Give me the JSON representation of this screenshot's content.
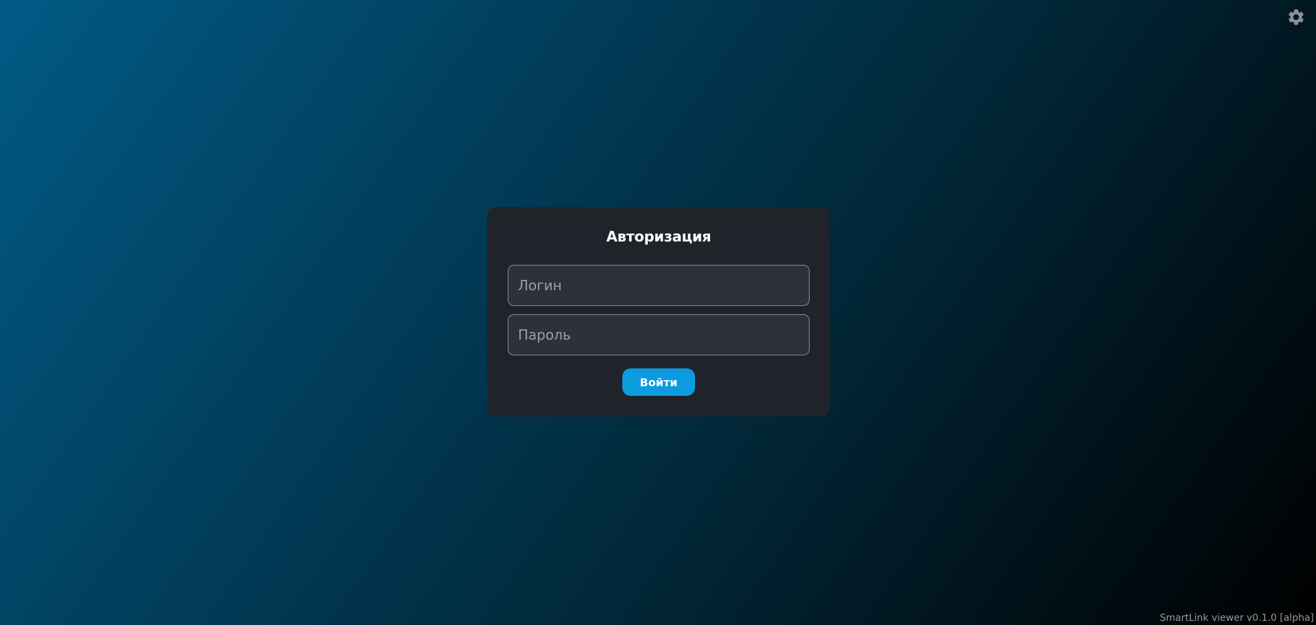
{
  "settings": {
    "icon": "gear-icon"
  },
  "login": {
    "title": "Авторизация",
    "login_placeholder": "Логин",
    "password_placeholder": "Пароль",
    "submit_label": "Войти"
  },
  "footer": {
    "version": "SmartLink viewer v0.1.0 [alpha]"
  },
  "colors": {
    "accent": "#0d9be0",
    "card_background": "#202329",
    "input_background": "#2d3139"
  }
}
